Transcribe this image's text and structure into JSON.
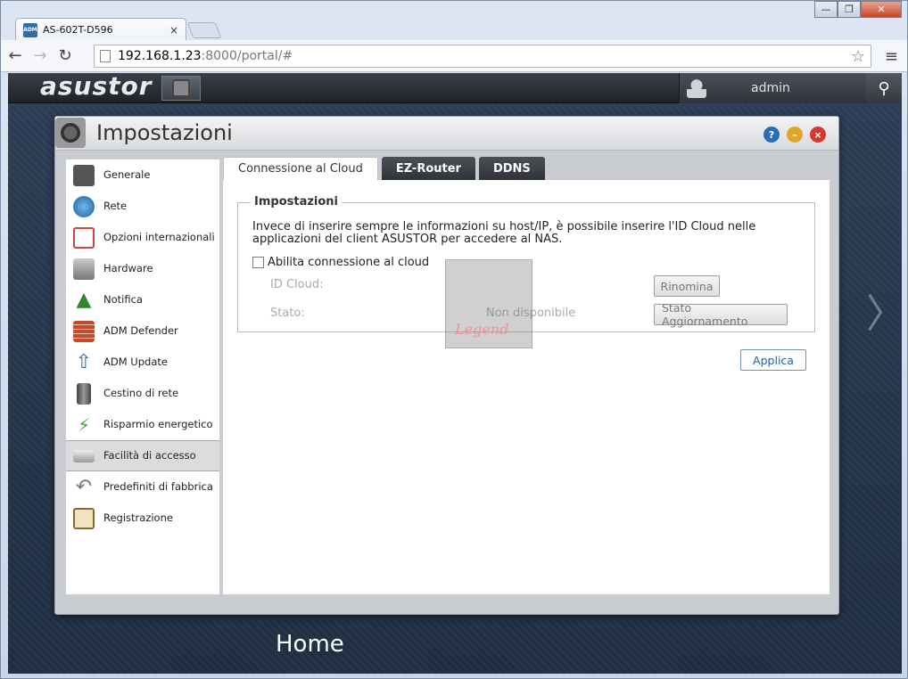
{
  "browser": {
    "tab_title": "AS-602T-D596",
    "tab_close": "×",
    "url_host": "192.168.1.23",
    "url_rest": ":8000/portal/#",
    "window_controls": {
      "minimize": "—",
      "maximize": "❐",
      "close": "✕"
    }
  },
  "adm": {
    "logo": "asustor",
    "user": "admin"
  },
  "settings": {
    "title": "Impostazioni",
    "sidebar": [
      {
        "label": "Generale",
        "icon": "server-icon"
      },
      {
        "label": "Rete",
        "icon": "network-globe-icon"
      },
      {
        "label": "Opzioni internazionali",
        "icon": "calendar-clock-icon"
      },
      {
        "label": "Hardware",
        "icon": "hard-disk-icon"
      },
      {
        "label": "Notifica",
        "icon": "warning-icon"
      },
      {
        "label": "ADM Defender",
        "icon": "firewall-icon"
      },
      {
        "label": "ADM Update",
        "icon": "update-arrow-icon"
      },
      {
        "label": "Cestino di rete",
        "icon": "trash-bin-icon"
      },
      {
        "label": "Risparmio energetico",
        "icon": "power-saving-icon"
      },
      {
        "label": "Facilità di accesso",
        "icon": "printer-access-icon",
        "active": true
      },
      {
        "label": "Predefiniti di fabbrica",
        "icon": "reset-arrow-icon"
      },
      {
        "label": "Registrazione",
        "icon": "clipboard-icon"
      }
    ],
    "tabs": [
      "Connessione al Cloud",
      "EZ-Router",
      "DDNS"
    ],
    "section_title": "Impostazioni",
    "description": "Invece di inserire sempre le informazioni su host/IP, è possibile inserire l'ID Cloud nelle applicazioni del client ASUSTOR per accedere al NAS.",
    "checkbox_label": "Abilita connessione al cloud",
    "id_cloud_label": "ID Cloud:",
    "rename_button": "Rinomina",
    "status_label": "Stato:",
    "status_value": "Non disponibile",
    "update_status_button": "Stato Aggiornamento",
    "apply_button": "Applica"
  },
  "desktop": {
    "home_label": "Home"
  },
  "watermark_text": "Legend"
}
